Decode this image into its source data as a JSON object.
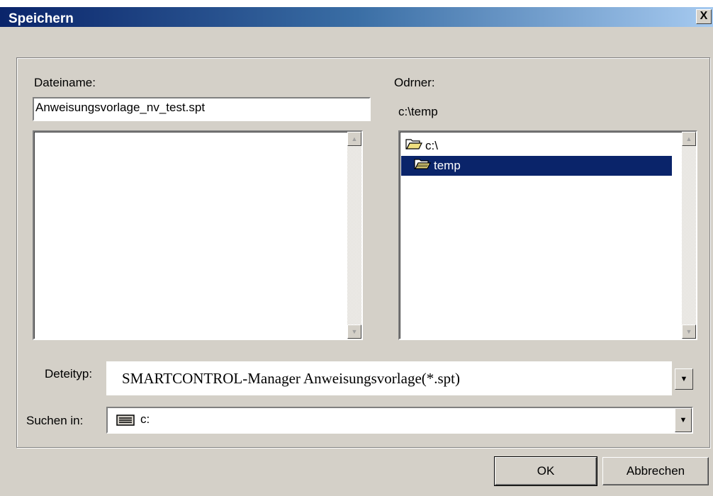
{
  "window": {
    "title": "Speichern",
    "close_glyph": "X"
  },
  "filename": {
    "label": "Dateiname:",
    "value": "Anweisungsvorlage_nv_test.spt"
  },
  "folder": {
    "label": "Odrner:",
    "value": "c:\\temp",
    "tree": [
      {
        "label": "c:\\",
        "icon": "open-folder-icon",
        "selected": false
      },
      {
        "label": "temp",
        "icon": "open-folder-icon",
        "selected": true
      }
    ]
  },
  "filetype": {
    "label": "Deteityp:",
    "value": "SMARTCONTROL-Manager Anweisungsvorlage(*.spt)"
  },
  "drive": {
    "label": "Suchen in:",
    "value": "c:",
    "icon": "drive-icon"
  },
  "buttons": {
    "ok": "OK",
    "cancel": "Abbrechen"
  },
  "colors": {
    "face": "#d4d0c8",
    "title_start": "#0a246a",
    "title_end": "#a6caf0",
    "selection": "#0a246a"
  }
}
